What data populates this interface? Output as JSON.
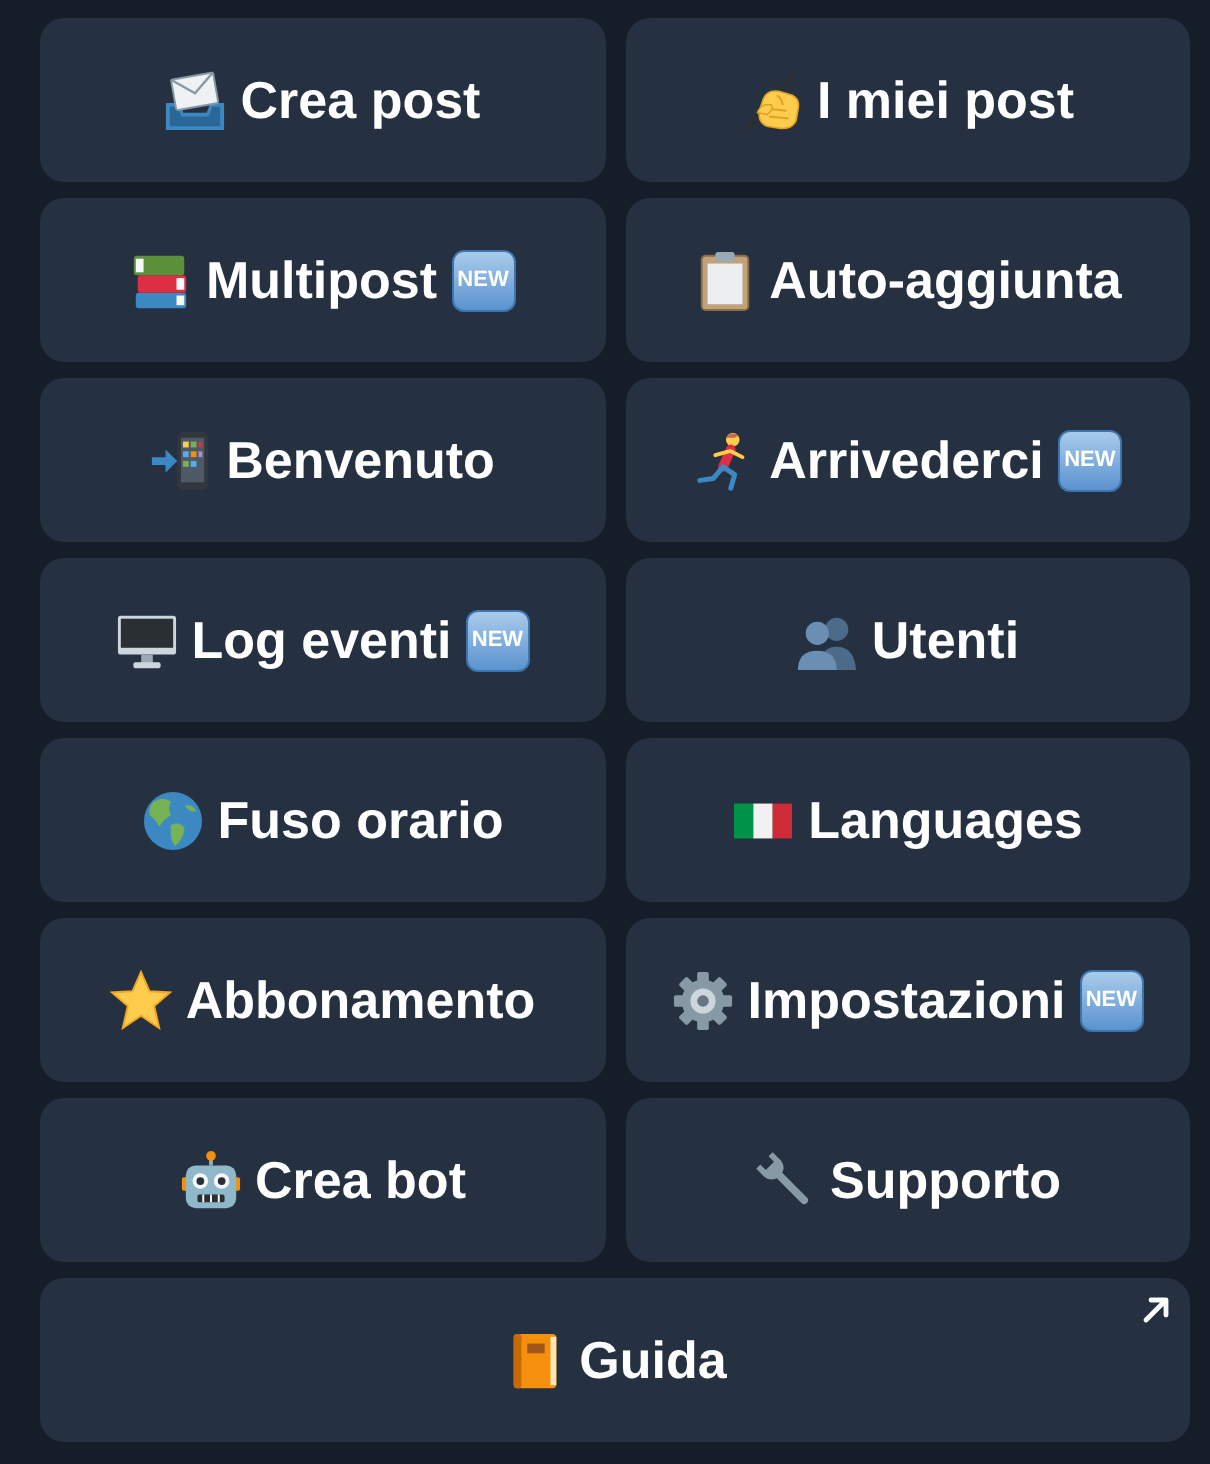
{
  "keyboard": {
    "rows": [
      {
        "buttons": [
          {
            "label": "Crea post",
            "external": false
          },
          {
            "label": "I miei post",
            "external": false
          }
        ]
      },
      {
        "buttons": [
          {
            "label": "Multipost",
            "badge": "NEW",
            "external": false
          },
          {
            "label": "Auto-aggiunta",
            "external": false
          }
        ]
      },
      {
        "buttons": [
          {
            "label": "Benvenuto",
            "external": false
          },
          {
            "label": "Arrivederci",
            "badge": "NEW",
            "external": false
          }
        ]
      },
      {
        "buttons": [
          {
            "label": "Log eventi",
            "badge": "NEW",
            "external": false
          },
          {
            "label": "Utenti",
            "external": false
          }
        ]
      },
      {
        "buttons": [
          {
            "label": "Fuso orario",
            "external": false
          },
          {
            "label": "Languages",
            "external": false
          }
        ]
      },
      {
        "buttons": [
          {
            "label": "Abbonamento",
            "external": false
          },
          {
            "label": "Impostazioni",
            "badge": "NEW",
            "external": false
          }
        ]
      },
      {
        "buttons": [
          {
            "label": "Crea bot",
            "external": false
          },
          {
            "label": "Supporto",
            "external": false
          }
        ]
      },
      {
        "buttons": [
          {
            "label": "Guida",
            "external": true
          }
        ]
      }
    ]
  }
}
